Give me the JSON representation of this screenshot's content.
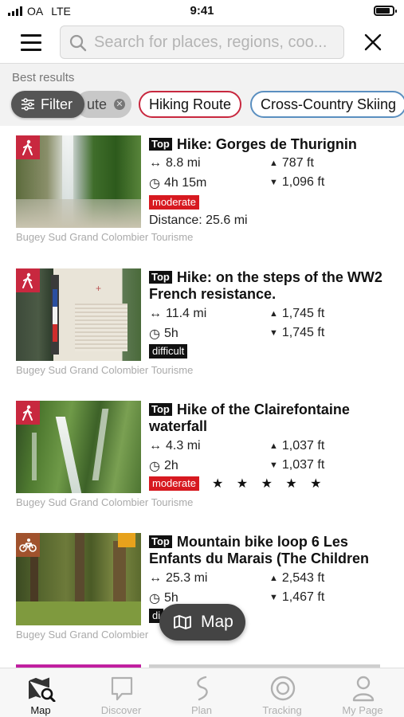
{
  "status": {
    "carrier": "OA",
    "network": "LTE",
    "time": "9:41"
  },
  "search": {
    "placeholder": "Search for places, regions, coo..."
  },
  "filters": {
    "best_results": "Best results",
    "filter_label": "Filter",
    "chips": [
      "ute",
      "Hiking Route",
      "Cross-Country Skiing"
    ]
  },
  "results": [
    {
      "top": "Top",
      "title": "Hike: Gorges de Thurignin",
      "distance": "8.8 mi",
      "duration": "4h 15m",
      "ascent": "787 ft",
      "descent": "1,096 ft",
      "difficulty": "moderate",
      "distance_from_me": "Distance: 25.6 mi",
      "source": "Bugey Sud Grand Colombier Tourisme",
      "category": "hiking"
    },
    {
      "top": "Top",
      "title": "Hike: on the steps of the WW2 French resistance.",
      "distance": "11.4 mi",
      "duration": "5h",
      "ascent": "1,745 ft",
      "descent": "1,745 ft",
      "difficulty": "difficult",
      "source": "Bugey Sud Grand Colombier Tourisme",
      "category": "hiking"
    },
    {
      "top": "Top",
      "title": "Hike of the Clairefontaine waterfall",
      "distance": "4.3 mi",
      "duration": "2h",
      "ascent": "1,037 ft",
      "descent": "1,037 ft",
      "difficulty": "moderate",
      "rating": "★ ★ ★ ★ ★",
      "source": "Bugey Sud Grand Colombier Tourisme",
      "category": "hiking"
    },
    {
      "top": "Top",
      "title": "Mountain bike loop 6 Les Enfants du Marais (The Children",
      "distance": "25.3 mi",
      "duration": "5h",
      "ascent": "2,543 ft",
      "descent": "1,467 ft",
      "difficulty": "di",
      "source": "Bugey Sud Grand Colombier",
      "category": "mountain-bike"
    }
  ],
  "map_button": "Map",
  "tabs": [
    "Map",
    "Discover",
    "Plan",
    "Tracking",
    "My Page"
  ],
  "colors": {
    "accent": "#c8283f",
    "moderate": "#d71920",
    "difficult": "#111111",
    "bike": "#a0522d",
    "ski": "#5a8fc0"
  }
}
